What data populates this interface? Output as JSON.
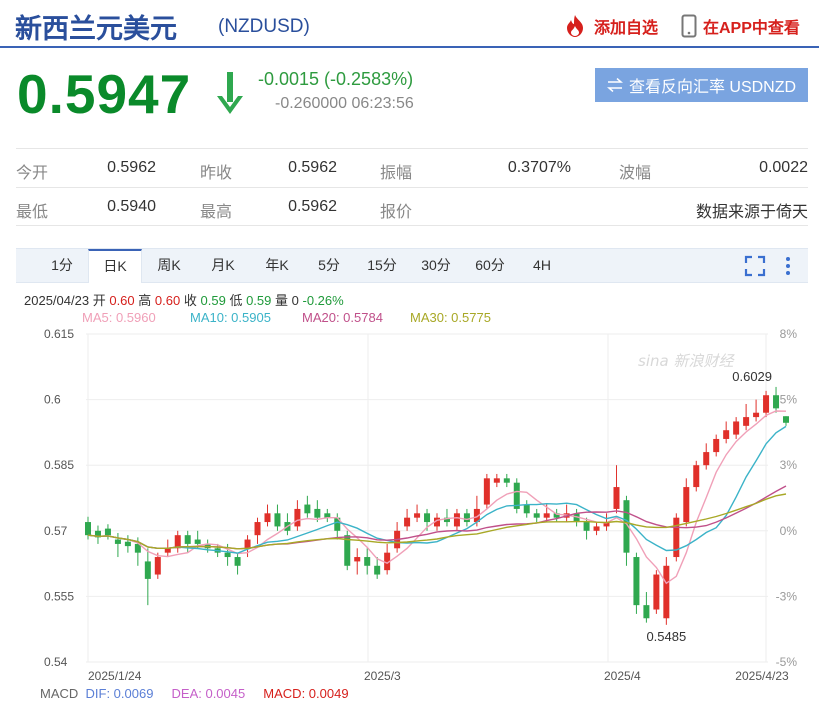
{
  "header": {
    "title": "新西兰元美元",
    "code": "(NZDUSD)",
    "add_watch": "添加自选",
    "view_app": "在APP中查看"
  },
  "quote": {
    "price": "0.5947",
    "direction": "down",
    "change": "-0.0015 (-0.2583%)",
    "sub": "-0.260000 06:23:56",
    "reverse_button": "查看反向汇率 USDNZD"
  },
  "stats": [
    [
      {
        "label": "今开",
        "value": "0.5962"
      },
      {
        "label": "昨收",
        "value": "0.5962"
      },
      {
        "label": "振幅",
        "value": "0.3707%"
      },
      {
        "label": "波幅",
        "value": "0.0022"
      }
    ],
    [
      {
        "label": "最低",
        "value": "0.5940"
      },
      {
        "label": "最高",
        "value": "0.5962"
      },
      {
        "label": "报价",
        "value": ""
      },
      {
        "label": "",
        "value": "数据来源于倚天"
      }
    ]
  ],
  "tabs": [
    "1分",
    "日K",
    "周K",
    "月K",
    "年K",
    "5分",
    "15分",
    "30分",
    "60分",
    "4H"
  ],
  "active_tab": "日K",
  "bar_info": {
    "date": "2025/04/23",
    "open_label": "开",
    "open": "0.60",
    "high_label": "高",
    "high": "0.60",
    "close_label": "收",
    "close": "0.59",
    "low_label": "低",
    "low": "0.59",
    "volume_label": "量",
    "volume": "0",
    "change": "-0.26%"
  },
  "ma_legend": [
    {
      "label": "MA5: 0.5960",
      "color": "#f0a0b8"
    },
    {
      "label": "MA10: 0.5905",
      "color": "#3bb3c8"
    },
    {
      "label": "MA20: 0.5784",
      "color": "#c0508a"
    },
    {
      "label": "MA30: 0.5775",
      "color": "#a8a826"
    }
  ],
  "macd_legend": {
    "name": "MACD",
    "dif": "DIF: 0.0069",
    "dea": "DEA: 0.0045",
    "macd": "MACD: 0.0049"
  },
  "watermark": "sina 新浪财经",
  "colors": {
    "up": "#e0302a",
    "down": "#2fa84f",
    "brand": "#2a4f9c",
    "price": "#0a8a2a"
  },
  "chart_data": {
    "type": "candlestick",
    "y_ticks": [
      "0.615",
      "0.6",
      "0.585",
      "0.57",
      "0.555",
      "0.54"
    ],
    "y_range": [
      0.54,
      0.615
    ],
    "pct_ticks": [
      "8%",
      "5%",
      "3%",
      "0%",
      "-3%",
      "-5%"
    ],
    "x_ticks": [
      "2025/1/24",
      "2025/3",
      "2025/4",
      "2025/4/23"
    ],
    "max_label": "0.6029",
    "min_label": "0.5485",
    "candles": [
      [
        0.572,
        0.569,
        0.5732,
        0.568
      ],
      [
        0.57,
        0.5685,
        0.5712,
        0.567
      ],
      [
        0.5705,
        0.569,
        0.5715,
        0.568
      ],
      [
        0.568,
        0.567,
        0.5695,
        0.564
      ],
      [
        0.5675,
        0.5665,
        0.569,
        0.565
      ],
      [
        0.567,
        0.565,
        0.5685,
        0.562
      ],
      [
        0.563,
        0.559,
        0.566,
        0.553
      ],
      [
        0.56,
        0.564,
        0.565,
        0.559
      ],
      [
        0.565,
        0.566,
        0.568,
        0.564
      ],
      [
        0.566,
        0.569,
        0.57,
        0.565
      ],
      [
        0.569,
        0.567,
        0.57,
        0.565
      ],
      [
        0.568,
        0.567,
        0.57,
        0.566
      ],
      [
        0.567,
        0.566,
        0.568,
        0.565
      ],
      [
        0.566,
        0.565,
        0.567,
        0.564
      ],
      [
        0.565,
        0.564,
        0.567,
        0.562
      ],
      [
        0.564,
        0.562,
        0.565,
        0.56
      ],
      [
        0.566,
        0.568,
        0.569,
        0.564
      ],
      [
        0.569,
        0.572,
        0.573,
        0.567
      ],
      [
        0.572,
        0.574,
        0.576,
        0.571
      ],
      [
        0.574,
        0.571,
        0.576,
        0.57
      ],
      [
        0.572,
        0.57,
        0.574,
        0.569
      ],
      [
        0.571,
        0.575,
        0.577,
        0.57
      ],
      [
        0.576,
        0.574,
        0.578,
        0.573
      ],
      [
        0.575,
        0.573,
        0.577,
        0.572
      ],
      [
        0.574,
        0.573,
        0.575,
        0.572
      ],
      [
        0.573,
        0.57,
        0.574,
        0.568
      ],
      [
        0.569,
        0.562,
        0.57,
        0.561
      ],
      [
        0.563,
        0.564,
        0.566,
        0.56
      ],
      [
        0.564,
        0.562,
        0.566,
        0.56
      ],
      [
        0.562,
        0.56,
        0.564,
        0.559
      ],
      [
        0.561,
        0.565,
        0.567,
        0.56
      ],
      [
        0.566,
        0.57,
        0.572,
        0.565
      ],
      [
        0.571,
        0.573,
        0.575,
        0.57
      ],
      [
        0.573,
        0.574,
        0.576,
        0.572
      ],
      [
        0.574,
        0.572,
        0.575,
        0.57
      ],
      [
        0.571,
        0.573,
        0.574,
        0.57
      ],
      [
        0.573,
        0.572,
        0.575,
        0.571
      ],
      [
        0.571,
        0.574,
        0.575,
        0.57
      ],
      [
        0.574,
        0.572,
        0.575,
        0.571
      ],
      [
        0.572,
        0.575,
        0.578,
        0.571
      ],
      [
        0.576,
        0.582,
        0.583,
        0.575
      ],
      [
        0.581,
        0.582,
        0.583,
        0.58
      ],
      [
        0.582,
        0.581,
        0.583,
        0.58
      ],
      [
        0.581,
        0.575,
        0.582,
        0.574
      ],
      [
        0.576,
        0.574,
        0.577,
        0.573
      ],
      [
        0.574,
        0.573,
        0.575,
        0.572
      ],
      [
        0.573,
        0.574,
        0.576,
        0.572
      ],
      [
        0.574,
        0.573,
        0.575,
        0.572
      ],
      [
        0.573,
        0.574,
        0.576,
        0.572
      ],
      [
        0.574,
        0.572,
        0.575,
        0.571
      ],
      [
        0.572,
        0.57,
        0.573,
        0.568
      ],
      [
        0.57,
        0.571,
        0.572,
        0.569
      ],
      [
        0.571,
        0.572,
        0.574,
        0.57
      ],
      [
        0.575,
        0.58,
        0.585,
        0.574
      ],
      [
        0.577,
        0.565,
        0.578,
        0.562
      ],
      [
        0.564,
        0.553,
        0.565,
        0.551
      ],
      [
        0.553,
        0.55,
        0.556,
        0.549
      ],
      [
        0.552,
        0.56,
        0.561,
        0.551
      ],
      [
        0.55,
        0.562,
        0.564,
        0.5485
      ],
      [
        0.564,
        0.573,
        0.574,
        0.563
      ],
      [
        0.572,
        0.58,
        0.582,
        0.571
      ],
      [
        0.58,
        0.585,
        0.586,
        0.579
      ],
      [
        0.585,
        0.588,
        0.59,
        0.584
      ],
      [
        0.588,
        0.591,
        0.592,
        0.587
      ],
      [
        0.591,
        0.593,
        0.595,
        0.59
      ],
      [
        0.592,
        0.595,
        0.596,
        0.591
      ],
      [
        0.594,
        0.596,
        0.599,
        0.593
      ],
      [
        0.596,
        0.597,
        0.6,
        0.595
      ],
      [
        0.597,
        0.601,
        0.602,
        0.596
      ],
      [
        0.601,
        0.598,
        0.6029,
        0.597
      ],
      [
        0.5962,
        0.5947,
        0.5962,
        0.594
      ]
    ]
  }
}
